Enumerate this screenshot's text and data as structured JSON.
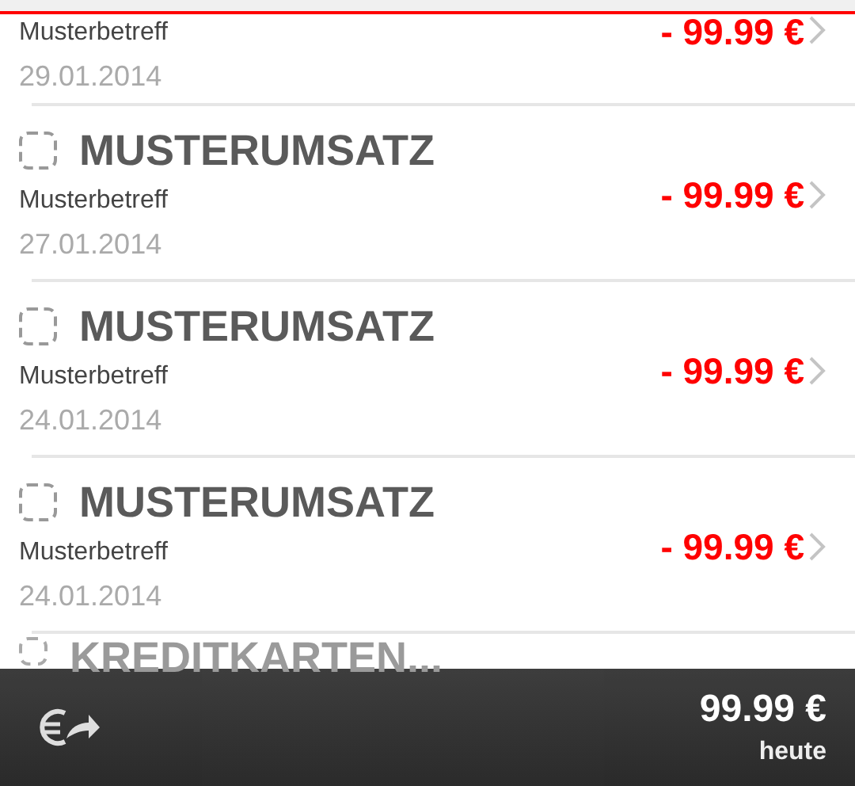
{
  "rows": [
    {
      "kind": "partial",
      "subtitle": "Musterbetreff",
      "amount": "- 99.99 €",
      "date": "29.01.2014"
    },
    {
      "kind": "full",
      "checked": false,
      "title": "MUSTERUMSATZ",
      "subtitle": "Musterbetreff",
      "amount": "- 99.99 €",
      "date": "27.01.2014"
    },
    {
      "kind": "full",
      "checked": false,
      "title": "MUSTERUMSATZ",
      "subtitle": "Musterbetreff",
      "amount": "- 99.99 €",
      "date": "24.01.2014"
    },
    {
      "kind": "full",
      "checked": false,
      "title": "MUSTERUMSATZ",
      "subtitle": "Musterbetreff",
      "amount": "- 99.99 €",
      "date": "24.01.2014"
    },
    {
      "kind": "covered",
      "checked": false,
      "title": "KREDITKARTEN..."
    }
  ],
  "footer": {
    "amount": "99.99 €",
    "label": "heute"
  }
}
